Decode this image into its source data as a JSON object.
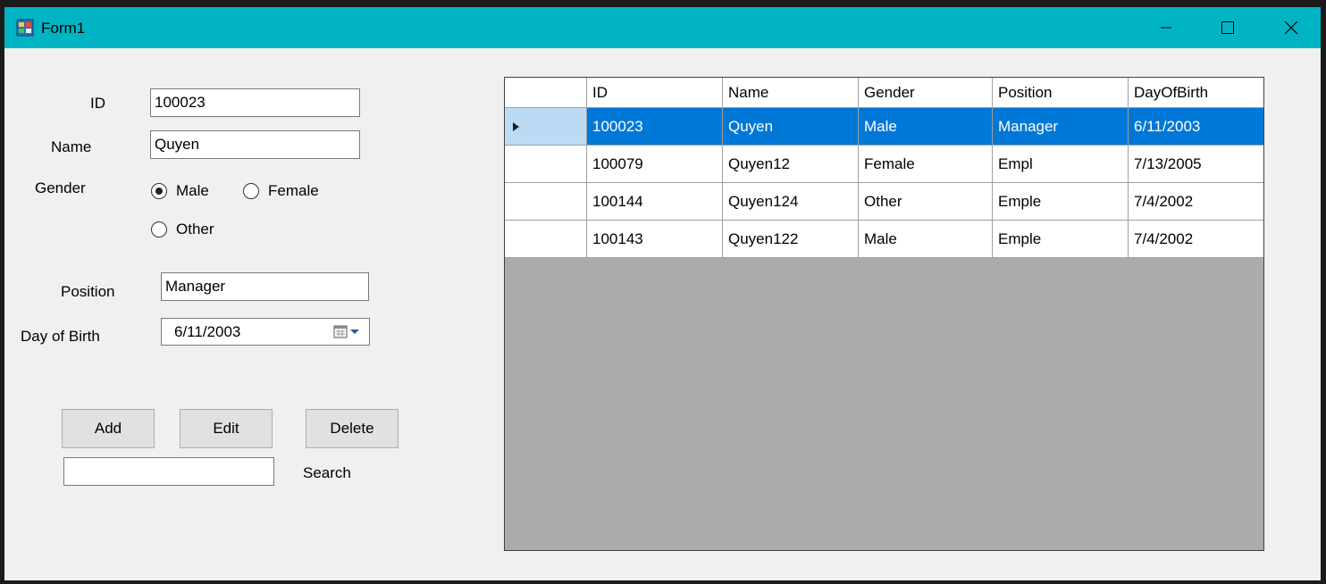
{
  "window": {
    "title": "Form1",
    "icons": {
      "app": "form-app-icon",
      "minimize": "minimize-icon",
      "maximize": "maximize-icon",
      "close": "close-icon"
    }
  },
  "form": {
    "id_label": "ID",
    "id_value": "100023",
    "name_label": "Name",
    "name_value": "Quyen",
    "gender_label": "Gender",
    "gender_options": [
      {
        "label": "Male",
        "checked": true
      },
      {
        "label": "Female",
        "checked": false
      },
      {
        "label": "Other",
        "checked": false
      }
    ],
    "position_label": "Position",
    "position_value": "Manager",
    "dob_label": "Day of Birth",
    "dob_value": "6/11/2003",
    "dob_icon": "calendar-dropdown-icon"
  },
  "actions": {
    "add_label": "Add",
    "edit_label": "Edit",
    "delete_label": "Delete",
    "search_value": "",
    "search_label": "Search"
  },
  "grid": {
    "columns": [
      "ID",
      "Name",
      "Gender",
      "Position",
      "DayOfBirth"
    ],
    "rows": [
      [
        "100023",
        "Quyen",
        "Male",
        "Manager",
        "6/11/2003"
      ],
      [
        "100079",
        "Quyen12",
        "Female",
        "Empl",
        "7/13/2005"
      ],
      [
        "100144",
        "Quyen124",
        "Other",
        "Emple",
        "7/4/2002"
      ],
      [
        "100143",
        "Quyen122",
        "Male",
        "Emple",
        "7/4/2002"
      ]
    ],
    "selected_row": 0,
    "current_row_icon": "row-pointer-icon"
  },
  "colors": {
    "titlebar": "#00b4c4",
    "selection": "#0078d7",
    "grid_background": "#ababab"
  }
}
